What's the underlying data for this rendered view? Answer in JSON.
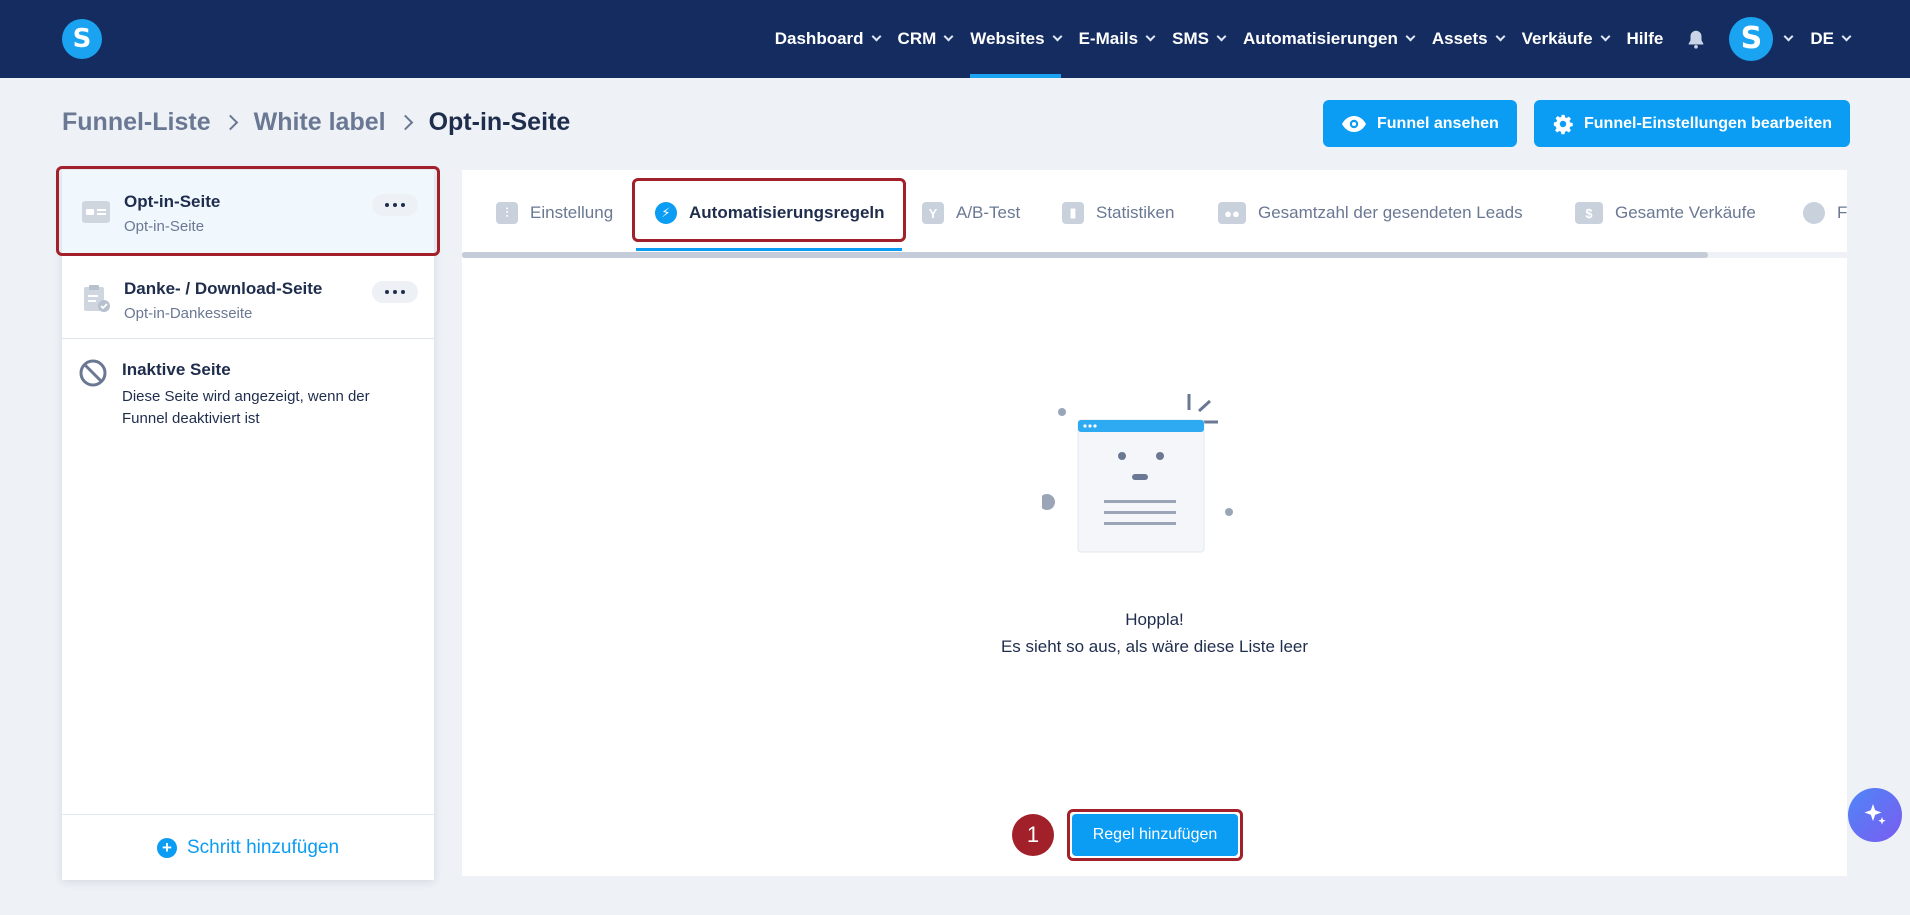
{
  "app": {
    "logo_letter": "S"
  },
  "nav": {
    "items": [
      {
        "label": "Dashboard"
      },
      {
        "label": "CRM"
      },
      {
        "label": "Websites"
      },
      {
        "label": "E-Mails"
      },
      {
        "label": "SMS"
      },
      {
        "label": "Automatisierungen"
      },
      {
        "label": "Assets"
      },
      {
        "label": "Verkäufe"
      }
    ],
    "help": "Hilfe",
    "avatar_letter": "S",
    "language": "DE",
    "active": "Websites",
    "icons": {
      "bell": "bell-icon"
    }
  },
  "breadcrumb": {
    "items": [
      {
        "label": "Funnel-Liste"
      },
      {
        "label": "White label"
      },
      {
        "label": "Opt-in-Seite"
      }
    ]
  },
  "actions": {
    "view_funnel": "Funnel ansehen",
    "edit_settings": "Funnel-Einstellungen bearbeiten"
  },
  "sidebar": {
    "steps": [
      {
        "title": "Opt-in-Seite",
        "subtitle": "Opt-in-Seite"
      },
      {
        "title": "Danke- / Download-Seite",
        "subtitle": "Opt-in-Dankesseite"
      }
    ],
    "inactive": {
      "title": "Inaktive Seite",
      "description": "Diese Seite wird angezeigt, wenn der Funnel deaktiviert ist"
    },
    "add_step": "Schritt hinzufügen"
  },
  "tabs": {
    "items": [
      {
        "label": "Einstellung"
      },
      {
        "label": "Automatisierungsregeln"
      },
      {
        "label": "A/B-Test"
      },
      {
        "label": "Statistiken"
      },
      {
        "label": "Gesamtzahl der gesendeten Leads"
      },
      {
        "label": "Gesamte Verkäufe"
      },
      {
        "label": "F"
      }
    ],
    "active": "Automatisierungsregeln"
  },
  "empty_state": {
    "title": "Hoppla!",
    "message": "Es sieht so aus, als wäre diese Liste leer"
  },
  "add_rule_button": "Regel hinzufügen",
  "step_badge": "1",
  "colors": {
    "nav_bg": "#142c5f",
    "accent": "#0b9cf3",
    "highlight": "#a1202a",
    "page_bg": "#eef2f7"
  }
}
